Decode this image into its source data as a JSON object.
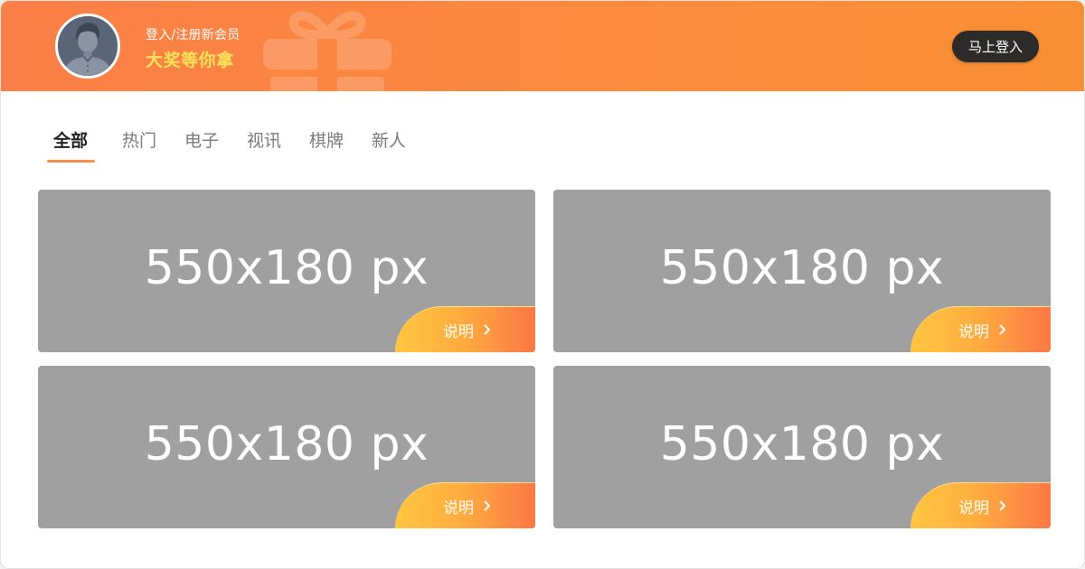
{
  "header": {
    "login_register_text": "登入/注册新会员",
    "promo_text": "大奖等你拿",
    "login_button_label": "马上登入",
    "icons": {
      "avatar": "user-avatar-icon",
      "gift": "gift-icon"
    },
    "colors": {
      "gradient_start": "#fb7f48",
      "gradient_end": "#f98f34",
      "promo_text": "#ffe45a",
      "login_button_bg": "#2d2a2a"
    }
  },
  "tabs": {
    "items": [
      {
        "label": "全部",
        "active": true
      },
      {
        "label": "热门",
        "active": false
      },
      {
        "label": "电子",
        "active": false
      },
      {
        "label": "视讯",
        "active": false
      },
      {
        "label": "棋牌",
        "active": false
      },
      {
        "label": "新人",
        "active": false
      }
    ],
    "active_color": "#222222",
    "inactive_color": "#7b7b7b",
    "underline_color": "#f98f45"
  },
  "cards": [
    {
      "placeholder_text": "550x180 px",
      "badge_label": "说明",
      "badge_icon": "chevron-right-icon"
    },
    {
      "placeholder_text": "550x180 px",
      "badge_label": "说明",
      "badge_icon": "chevron-right-icon"
    },
    {
      "placeholder_text": "550x180 px",
      "badge_label": "说明",
      "badge_icon": "chevron-right-icon"
    },
    {
      "placeholder_text": "550x180 px",
      "badge_label": "说明",
      "badge_icon": "chevron-right-icon"
    }
  ],
  "card_colors": {
    "placeholder_bg": "#a0a0a0",
    "badge_gradient_start": "#ffc640",
    "badge_gradient_end": "#fb7845"
  }
}
